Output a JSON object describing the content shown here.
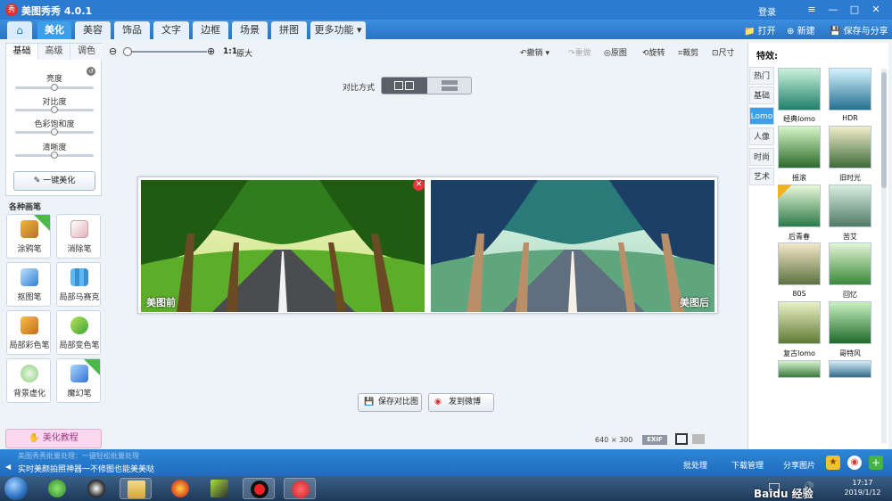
{
  "app": {
    "title": "美图秀秀 4.0.1",
    "logo_text": "秀",
    "login": "登录",
    "win_controls": [
      "≡",
      "—",
      "□",
      "✕"
    ]
  },
  "nav": {
    "tabs": [
      "美化",
      "美容",
      "饰品",
      "文字",
      "边框",
      "场景",
      "拼图",
      "更多功能 ▾"
    ],
    "active_tab": "美化",
    "right_actions": [
      "打开",
      "新建",
      "保存与分享"
    ]
  },
  "left": {
    "subtabs": [
      "基础",
      "高级",
      "调色"
    ],
    "active_subtab": "基础",
    "sliders": [
      "亮度",
      "对比度",
      "色彩饱和度",
      "清晰度"
    ],
    "one_click": "一键美化",
    "brush_section": "各种画笔",
    "brushes": [
      "涂鸦笔",
      "消除笔",
      "抠图笔",
      "局部马赛克",
      "局部彩色笔",
      "局部变色笔",
      "背景虚化",
      "魔幻笔"
    ],
    "tutorial": "美化教程"
  },
  "toolbar": {
    "zoom_ratio": "1:1",
    "zoom_label": "原大",
    "actions": [
      "撤销",
      "重做",
      "原图",
      "旋转",
      "裁剪",
      "尺寸"
    ]
  },
  "compare": {
    "label": "对比方式"
  },
  "photos": {
    "before_caption": "美图前",
    "after_caption": "美图后"
  },
  "bottom_buttons": {
    "save_compare": "保存对比图",
    "weibo": "发到微博"
  },
  "image_info": {
    "width": "640",
    "times": "×",
    "height": "300",
    "exif": "EXIF"
  },
  "effects": {
    "title": "特效:",
    "categories": [
      "热门",
      "基础",
      "Lomo",
      "人像",
      "时尚",
      "艺术"
    ],
    "active_category": "Lomo",
    "items": [
      "经典lomo",
      "HDR",
      "摇滚",
      "旧时光",
      "后青春",
      "苦艾",
      "80S",
      "回忆",
      "复古lomo",
      "哥特风"
    ]
  },
  "status": {
    "tip_faded": "美图秀秀批量处理：一键轻松批量处理",
    "tip": "实时美颜拍照神器一不修图也能美美哒",
    "right_links": [
      "批处理",
      "下载管理",
      "分享图片"
    ]
  },
  "taskbar": {
    "time": "17:17",
    "date": "2019/1/12",
    "watermark": "Baidu 经验 jingyan.baidu.com"
  },
  "colors": {
    "accent_blue": "#2b7bd0",
    "active_tab": "#3d9fe8",
    "close_red": "#e4363c"
  }
}
